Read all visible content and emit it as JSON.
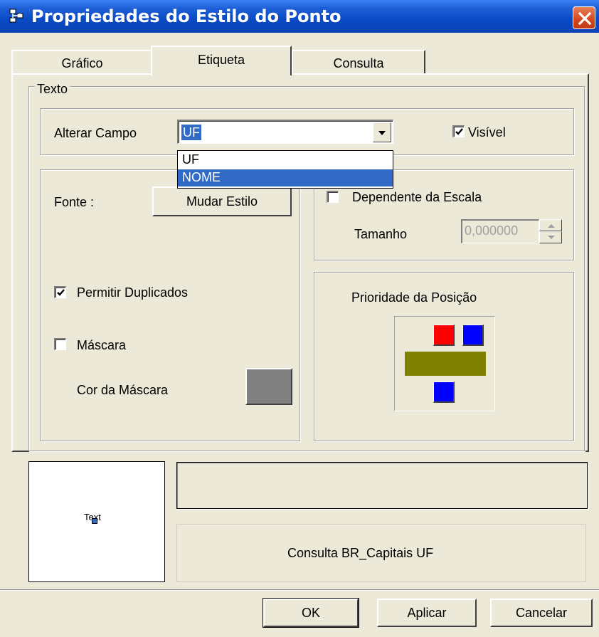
{
  "window": {
    "title": "Propriedades do Estilo do Ponto"
  },
  "tabs": [
    {
      "label": "Gráfico",
      "active": false
    },
    {
      "label": "Etiqueta",
      "active": true
    },
    {
      "label": "Consulta",
      "active": false
    }
  ],
  "texto_group": {
    "legend": "Texto"
  },
  "campo": {
    "label": "Alterar Campo",
    "selected_value": "UF",
    "options": [
      "UF",
      "NOME"
    ],
    "highlighted_option": "NOME"
  },
  "visivel": {
    "label": "Visível",
    "checked": true
  },
  "fonte": {
    "label": "Fonte :",
    "button_label": "Mudar Estilo"
  },
  "duplicados": {
    "label": "Permitir Duplicados",
    "checked": true
  },
  "mascara": {
    "label": "Máscara",
    "checked": false,
    "color_label": "Cor da Máscara",
    "color": "#808080"
  },
  "escala": {
    "label": "Dependente da Escala",
    "checked": false,
    "size_label": "Tamanho",
    "size_value": "0,000000"
  },
  "posicao": {
    "label": "Prioridade da Posição",
    "colors": {
      "red": "#ff0000",
      "blue": "#0000ff",
      "olive": "#808000"
    }
  },
  "preview": {
    "text": "Text"
  },
  "consulta_text": "Consulta BR_Capitais UF",
  "footer": {
    "ok": "OK",
    "apply": "Aplicar",
    "cancel": "Cancelar"
  }
}
